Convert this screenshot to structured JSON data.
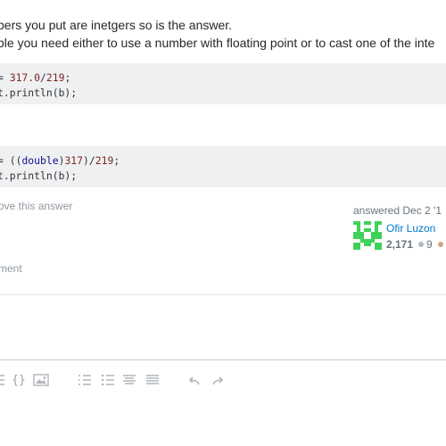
{
  "answer": {
    "text_line_1": "bers you put are inetgers so is the answer.",
    "text_line_2": "ble you need either to use a number with floating point or to cast one of the inte",
    "code_block_1": {
      "line_1": {
        "prefix": "= ",
        "num": "317.0",
        "op": "/",
        "num2": "219",
        "suffix": ";"
      },
      "line_2": "t.println(b);"
    },
    "code_block_2": {
      "line_1": {
        "prefix": "= ((",
        "kw": "double",
        "mid": ")",
        "num": "317",
        "op": ")/",
        "num2": "219",
        "suffix": ";"
      },
      "line_2": "t.println(b);"
    },
    "improve_link": "ove this answer",
    "comment_link": "ment"
  },
  "user_card": {
    "action_time": "answered Dec 2 '1",
    "name": "Ofir Luzon",
    "reputation": "2,171",
    "silver_badges": "9",
    "colors": {
      "link": "#0077cc",
      "silver": "#b4b8bc",
      "bronze": "#d1a684"
    }
  },
  "editor_toolbar": {
    "icons": [
      "code-icon",
      "image-icon",
      "ordered-list-icon",
      "unordered-list-icon",
      "heading-icon",
      "horizontal-rule-icon",
      "undo-icon",
      "redo-icon"
    ],
    "code_glyph": "{}"
  }
}
